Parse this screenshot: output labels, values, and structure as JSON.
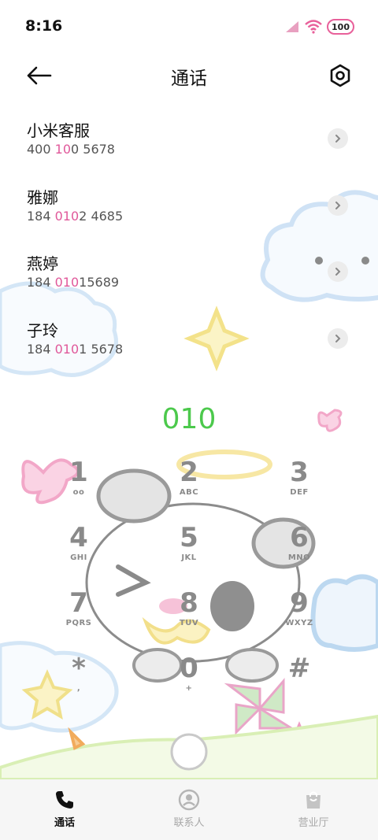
{
  "status_bar": {
    "time": "8:16",
    "battery": "100"
  },
  "header": {
    "title": "通话"
  },
  "contacts": [
    {
      "name": "小米客服",
      "number_parts": [
        {
          "text": "400",
          "hl": false
        },
        {
          "text": " 10",
          "hl": true
        },
        {
          "text": "0 5678",
          "hl": false
        }
      ]
    },
    {
      "name": "雅娜",
      "number_parts": [
        {
          "text": "184 ",
          "hl": false
        },
        {
          "text": "010",
          "hl": true
        },
        {
          "text": "2 4685",
          "hl": false
        }
      ]
    },
    {
      "name": "燕婷",
      "number_parts": [
        {
          "text": "184 ",
          "hl": false
        },
        {
          "text": "010",
          "hl": true
        },
        {
          "text": "15689",
          "hl": false
        }
      ]
    },
    {
      "name": "子玲",
      "number_parts": [
        {
          "text": "184 ",
          "hl": false
        },
        {
          "text": "010",
          "hl": true
        },
        {
          "text": "1 5678",
          "hl": false
        }
      ]
    }
  ],
  "dialer": {
    "display": "010"
  },
  "keypad": [
    {
      "digit": "1",
      "letters": "oo"
    },
    {
      "digit": "2",
      "letters": "ABC"
    },
    {
      "digit": "3",
      "letters": "DEF"
    },
    {
      "digit": "4",
      "letters": "GHI"
    },
    {
      "digit": "5",
      "letters": "JKL"
    },
    {
      "digit": "6",
      "letters": "MNO"
    },
    {
      "digit": "7",
      "letters": "PQRS"
    },
    {
      "digit": "8",
      "letters": "TUV"
    },
    {
      "digit": "9",
      "letters": "WXYZ"
    },
    {
      "digit": "*",
      "letters": ","
    },
    {
      "digit": "0",
      "letters": "+"
    },
    {
      "digit": "#",
      "letters": ""
    }
  ],
  "bottom_nav": [
    {
      "label": "通话",
      "icon": "phone-icon",
      "active": true
    },
    {
      "label": "联系人",
      "icon": "person-icon",
      "active": false
    },
    {
      "label": "营业厅",
      "icon": "shopping-bag-icon",
      "active": false
    }
  ],
  "colors": {
    "highlight": "#e0589a",
    "dial_green": "#4cc94c",
    "battery_ring": "#e8609a"
  }
}
